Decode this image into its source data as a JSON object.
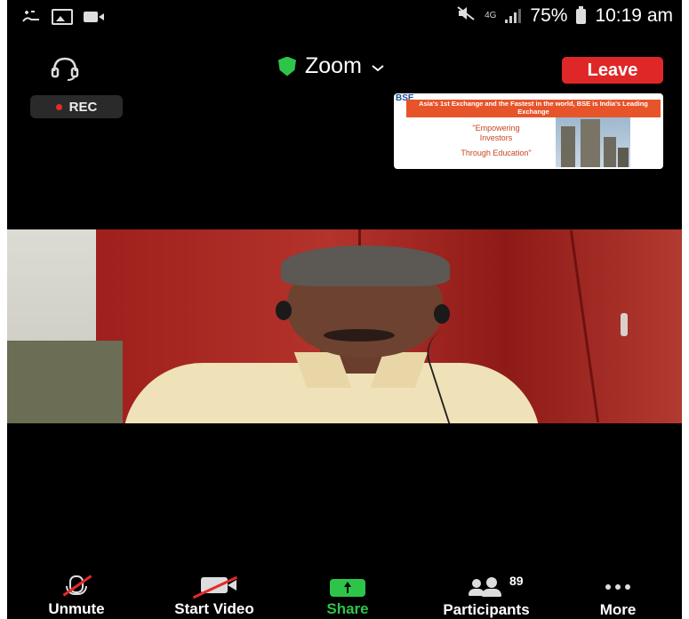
{
  "status_bar": {
    "network": "4G",
    "battery": "75%",
    "time": "10:19 am"
  },
  "header": {
    "meeting_title": "Zoom",
    "leave_label": "Leave",
    "rec_label": "REC"
  },
  "shared_slide": {
    "logo": "BSE",
    "banner": "Asia's 1st Exchange and the Fastest in the world, BSE is India's Leading Exchange",
    "quote_line1": "\"Empowering",
    "quote_line2": "Investors",
    "quote_line3": "Through Education\""
  },
  "toolbar": {
    "unmute_label": "Unmute",
    "start_video_label": "Start Video",
    "share_label": "Share",
    "participants_label": "Participants",
    "participants_count": "89",
    "more_label": "More"
  },
  "colors": {
    "leave_red": "#e02727",
    "share_green": "#2ec44a",
    "shield_green": "#2ec44a",
    "rec_red": "#e52a2a"
  }
}
